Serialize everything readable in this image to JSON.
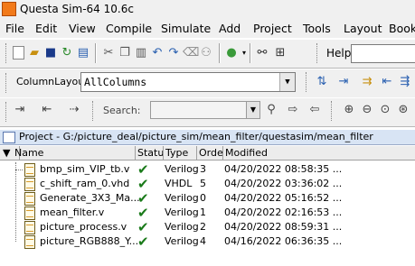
{
  "window": {
    "title": "Questa Sim-64 10.6c"
  },
  "menu": [
    "File",
    "Edit",
    "View",
    "Compile",
    "Simulate",
    "Add",
    "Project",
    "Tools",
    "Layout",
    "Bookm"
  ],
  "toolbar": {
    "help_label": "Help",
    "column_layout_label": "ColumnLayout",
    "column_layout_value": "AllColumns",
    "search_label": "Search:"
  },
  "project_bar": {
    "text": "Project - G:/picture_deal/picture_sim/mean_filter/questasim/mean_filter"
  },
  "table": {
    "columns": [
      "Name",
      "Status",
      "Type",
      "Order",
      "Modified"
    ],
    "rows": [
      {
        "name": "bmp_sim_VIP_tb.v",
        "status": "ok",
        "type": "Verilog",
        "order": "3",
        "modified": "04/20/2022 08:58:35 ..."
      },
      {
        "name": "c_shift_ram_0.vhd",
        "status": "ok",
        "type": "VHDL",
        "order": "5",
        "modified": "04/20/2022 03:36:02 ..."
      },
      {
        "name": "Generate_3X3_Ma...",
        "status": "ok",
        "type": "Verilog",
        "order": "0",
        "modified": "04/20/2022 05:16:52 ..."
      },
      {
        "name": "mean_filter.v",
        "status": "ok",
        "type": "Verilog",
        "order": "1",
        "modified": "04/20/2022 02:16:53 ..."
      },
      {
        "name": "picture_process.v",
        "status": "ok",
        "type": "Verilog",
        "order": "2",
        "modified": "04/20/2022 08:59:31 ..."
      },
      {
        "name": "picture_RGB888_Y...",
        "status": "ok",
        "type": "Verilog",
        "order": "4",
        "modified": "04/16/2022 06:36:35 ..."
      }
    ]
  }
}
